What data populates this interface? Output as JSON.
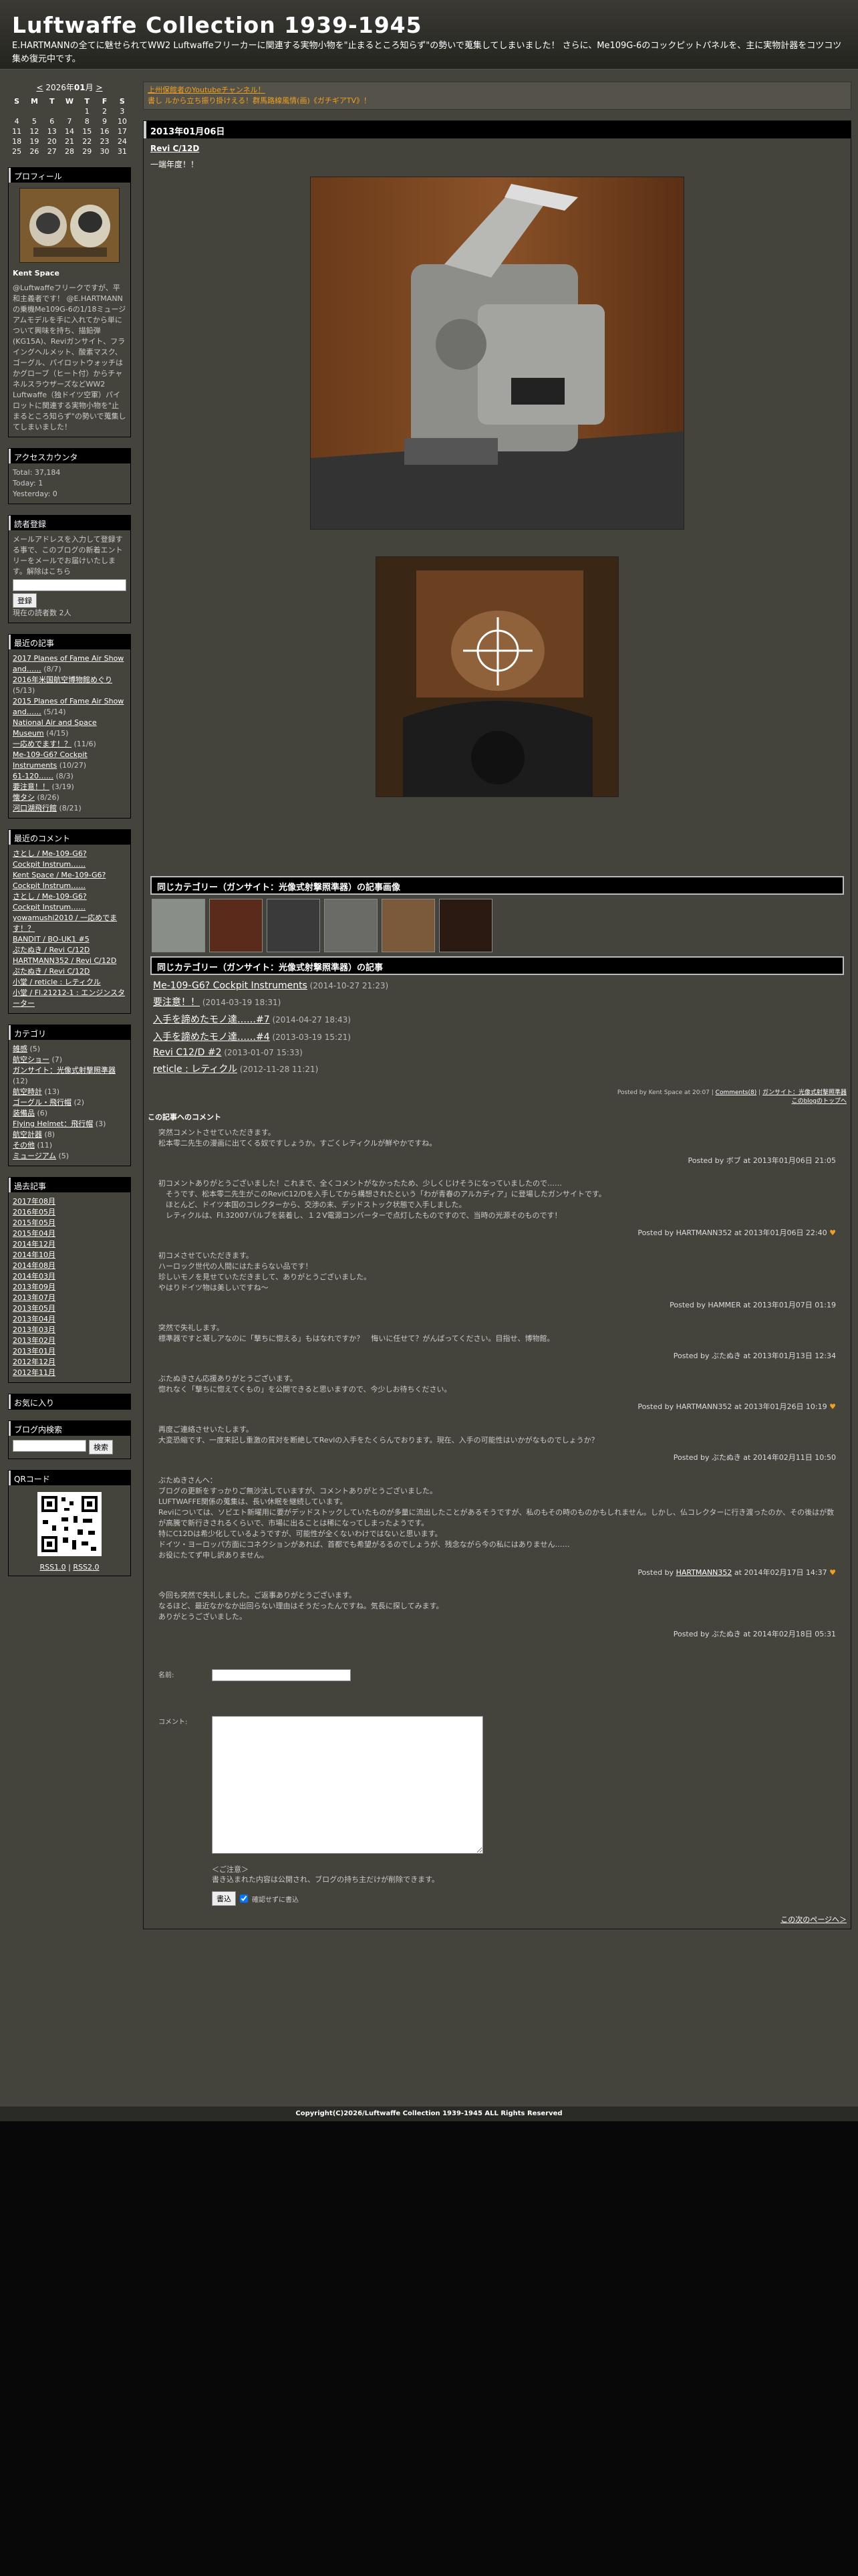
{
  "header": {
    "title": "Luftwaffe Collection 1939-1945",
    "description": "E.HARTMANNの全てに魅せられてWW2 Luftwaffeフリーカーに関連する実物小物を\"止まるところ知らず\"の勢いで蒐集してしまいました！ さらに、Me109G-6のコックピットパネルを、主に実物計器をコツコツ集め復元中です。"
  },
  "calendar": {
    "prev": "<",
    "year_label": "2026年",
    "month": "01",
    "month_suffix": "月",
    "next": ">",
    "day_names": [
      "S",
      "M",
      "T",
      "W",
      "T",
      "F",
      "S"
    ],
    "weeks": [
      [
        "",
        "",
        "",
        "",
        "1",
        "2",
        "3"
      ],
      [
        "4",
        "5",
        "6",
        "7",
        "8",
        "9",
        "10"
      ],
      [
        "11",
        "12",
        "13",
        "14",
        "15",
        "16",
        "17"
      ],
      [
        "18",
        "19",
        "20",
        "21",
        "22",
        "23",
        "24"
      ],
      [
        "25",
        "26",
        "27",
        "28",
        "29",
        "30",
        "31"
      ]
    ]
  },
  "profile": {
    "title": "プロフィール",
    "name": "Kent Space",
    "bio": "@Luftwaffeフリークですが、平和主義者です！ @E.HARTMANNの乗機Me109G-6の1/18ミュージアムモデルを手に入れてから単について興味を持ち、描鉛弾(KG15A)、Reviガンサイト、フライングヘルメット、酸素マスク、ゴーグル、パイロットウォッチはかグローブ（ヒート付）からチャネルスラウザーズなどWW2 Luftwaffe（独ドイツ空軍）パイロットに関連する実物小物を\"止まるところ知らず\"の勢いで蒐集してしまいました！"
  },
  "access": {
    "title": "アクセスカウンタ",
    "total": "Total: 37,184",
    "today": "Today: 1",
    "yesterday": "Yesterday: 0"
  },
  "subscribe": {
    "title": "読者登録",
    "text": "メールアドレスを入力して登録する事で、このブログの新着エントリーをメールでお届けいたします。解除はこちら",
    "button": "登録",
    "count": "現在の読者数 2人"
  },
  "recent_articles": {
    "title": "最近の記事",
    "items": [
      {
        "label": "2017 Planes of Fame Air Show and……",
        "date": "(8/7)"
      },
      {
        "label": "2016年米国航空博物館めぐり",
        "date": "(5/13)"
      },
      {
        "label": "2015 Planes of Fame Air Show and……",
        "date": "(5/14)"
      },
      {
        "label": "National Air and Space Museum",
        "date": "(4/15)"
      },
      {
        "label": "一応めでます！？",
        "date": "(11/6)"
      },
      {
        "label": "Me-109-G6? Cockpit Instruments",
        "date": "(10/27)"
      },
      {
        "label": "61-120……",
        "date": "(8/3)"
      },
      {
        "label": "要注意！！",
        "date": "(3/19)"
      },
      {
        "label": "懐タシ",
        "date": "(8/26)"
      },
      {
        "label": "河口湖飛行館",
        "date": "(8/21)"
      }
    ]
  },
  "recent_comments": {
    "title": "最近のコメント",
    "items": [
      "さとし / Me-109-G6?",
      "Cockpit Instrum……",
      "Kent Space / Me-109-G6?",
      "Cockpit Instrum……",
      "さとし / Me-109-G6?",
      "Cockpit Instrum……",
      "yowamushi2010 / 一応めでます！？",
      "BANDIT / BO-UK1 #5",
      "ぷたぬき / Revi C/12D",
      "HARTMANN352 / Revi C/12D",
      "ぷたぬき / Revi C/12D",
      "小堂 / reticle : レティクル",
      "小堂 / Fl.21212-1 : エンジンスターター"
    ]
  },
  "categories": {
    "title": "カテゴリ",
    "items": [
      {
        "label": "雑感",
        "count": "(5)"
      },
      {
        "label": "航空ショー",
        "count": "(7)"
      },
      {
        "label": "ガンサイト：光像式射撃照準器",
        "count": "(12)"
      },
      {
        "label": "航空時計",
        "count": "(13)"
      },
      {
        "label": "ゴーグル・飛行帽",
        "count": "(2)"
      },
      {
        "label": "装備品",
        "count": "(6)"
      },
      {
        "label": "Flying Helmet：飛行帽",
        "count": "(3)"
      },
      {
        "label": "航空計器",
        "count": "(8)"
      },
      {
        "label": "その他",
        "count": "(11)"
      },
      {
        "label": "ミュージアム",
        "count": "(5)"
      }
    ]
  },
  "archives": {
    "title": "過去記事",
    "items": [
      "2017年08月",
      "2016年05月",
      "2015年05月",
      "2015年04月",
      "2014年12月",
      "2014年10月",
      "2014年08月",
      "2014年03月",
      "2013年09月",
      "2013年07月",
      "2013年05月",
      "2013年04月",
      "2013年03月",
      "2013年02月",
      "2013年01月",
      "2012年12月",
      "2012年11月"
    ]
  },
  "favorites": {
    "title": "お気に入り"
  },
  "search": {
    "title": "ブログ内検索",
    "button": "検索"
  },
  "qr": {
    "title": "QRコード",
    "rss1": "RSS1.0",
    "rss2": "RSS2.0"
  },
  "notice": {
    "line1": "上州保館者のYoutubeチャンネル！",
    "line2": "書し ルから立ち振り掛けえる！群馬路線風情(画)《ガチギアTV》！"
  },
  "entry": {
    "date": "2013年01月06日",
    "title": "Revi C/12D",
    "text": "一端年度！！"
  },
  "related": {
    "images_title": "同じカテゴリー（ガンサイト：光像式射撃照準器）の記事画像",
    "articles_title": "同じカテゴリー（ガンサイト：光像式射撃照準器）の記事",
    "articles": [
      {
        "label": "Me-109-G6? Cockpit Instruments",
        "date": "(2014-10-27 21:23)"
      },
      {
        "label": "要注意！！",
        "date": "(2014-03-19 18:31)"
      },
      {
        "label": "入手を諦めたモノ達……#7",
        "date": "(2014-04-27 18:43)"
      },
      {
        "label": "入手を諦めたモノ達……#4",
        "date": "(2013-03-19 15:21)"
      },
      {
        "label": "Revi C12/D #2",
        "date": "(2013-01-07 15:33)"
      },
      {
        "label": "reticle : レティクル",
        "date": "(2012-11-28 11:21)"
      }
    ]
  },
  "posted": {
    "text": "Posted by Kent Space at 20:07",
    "comments_link": "Comments(8)",
    "category_link": "ガンサイト：光像式射撃照準器",
    "top_link": "このblogのトップへ"
  },
  "comments": {
    "title": "この記事へのコメント",
    "items": [
      {
        "lines": [
          "突然コメントさせていただきます。",
          "松本零二先生の漫画に出てくる奴ですしょうか。すごくレティクルが鮮やかですね。"
        ],
        "meta": "Posted by ボブ at 2013年01月06日 21:05",
        "heart": false
      },
      {
        "lines": [
          "初コメントありがとうございました！これまで、全くコメントがなかったため、少しくじけそうになっていましたので……",
          "　そうです、松本零二先生がこのReviC12/Dを入手してから構想されたという「わが青春のアルカディア」に登場したガンサイトです。",
          "　ほとんど、ドイツ本国のコレクターから、交渉の末、デッドストック状態で入手しました。",
          "　レティクルは、FI.32007バルブを装着し、１２V電源コンバーターで点灯したものですので、当時の光源そのものです！"
        ],
        "meta": "Posted by HARTMANN352 at 2013年01月06日 22:40",
        "heart": true
      },
      {
        "lines": [
          "初コメさせていただきます。",
          "ハーロック世代の人間にはたまらない品です！",
          "珍しいモノを見せていただきまして、ありがとうございました。",
          "やはりドイツ物は美しいですね～"
        ],
        "meta": "Posted by HAMMER at 2013年01月07日 01:19",
        "heart": false
      },
      {
        "lines": [
          "突然で失礼します。",
          "標準器ですと凝しアなのに「撃ちに惚える」もはなれですか？　悔いに任せて？がんばってください。目指せ、博物館。"
        ],
        "meta": "Posted by ぶたぬき at 2013年01月13日 12:34",
        "heart": false
      },
      {
        "lines": [
          "ぶたぬきさん応援ありがとうございます。",
          "惚れなく「撃ちに惚えてくもの」を公開できると思いますので、今少しお待ちください。"
        ],
        "meta": "Posted by HARTMANN352 at 2013年01月26日 10:19",
        "heart": true
      },
      {
        "lines": [
          "再度ご連絡させいたします。",
          "大変恐縮です、一度来記し重激の質対を断絶してRevlの入手をたくらんでおります。現在、入手の可能性はいかがなものでしょうか？"
        ],
        "meta": "Posted by ぶたぬき at 2014年02月11日 10:50",
        "heart": false
      },
      {
        "lines": [
          "ぶたぬきさんへ：",
          "ブログの更新をすっかりご無沙汰していますが、コメントありがとうございました。",
          "LUFTWAFFE関係の蒐集は、長い休眠を継続しています。",
          "Reviについては、ソビエト新曜用に要がデッドストックしていたものが多量に流出したことがあるそうですが、私のもその時のものかもしれません。しかし、仏コレクターに行き渡ったのか、その後はが数が高騰で新行きされるくらいで、市場に出ることは稀になってしまったようです。",
          "特にC12Dは希少化しているようですが、可能性が全くないわけではないと思います。",
          "ドイツ・ヨーロッパ方面にコネクションがあれば、首都でも希望がるるのでしょうが、残念ながら今の私にはありません……",
          "お役にたてず申し訳ありません。"
        ],
        "meta_pre": "Posted by ",
        "meta_name": "HARTMANN352",
        "meta_post": " at 2014年02月17日 14:37",
        "heart": true
      },
      {
        "lines": [
          "今回も突然で失礼しました。ご返事ありがとうございます。",
          "なるほど、最近なかなか出回らない理由はそうだったんですね。気長に探してみます。",
          "ありがとうございました。"
        ],
        "meta": "Posted by ぶたぬき at 2014年02月18日 05:31",
        "heart": false
      }
    ]
  },
  "form": {
    "name_label": "名前:",
    "comment_label": "コメント:",
    "note_title": "＜ご注意＞",
    "note": "書き込まれた内容は公開され、ブログの持ち主だけが削除できます。",
    "submit": "書込",
    "remember": "確認せずに書込",
    "next_page": "この次のページへ＞"
  },
  "footer": {
    "copyright": "Copyright(C)2026/Luftwaffe Collection 1939-1945 ALL Rights Reserved"
  }
}
